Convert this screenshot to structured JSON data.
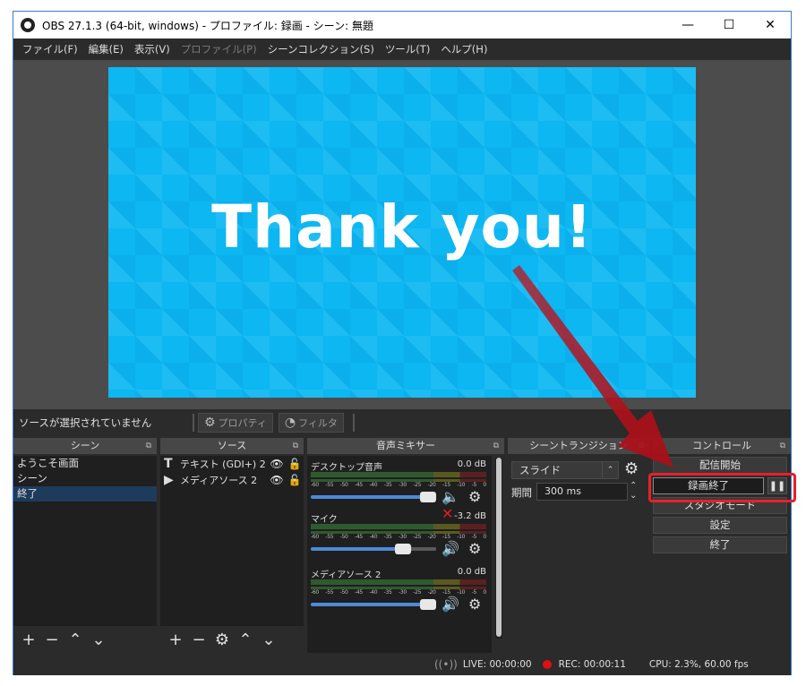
{
  "window": {
    "title": "OBS 27.1.3 (64-bit, windows) - プロファイル: 録画 - シーン: 無題",
    "controls": {
      "minimize": "—",
      "maximize": "☐",
      "close": "✕"
    }
  },
  "menu": [
    {
      "label": "ファイル(F)",
      "disabled": false
    },
    {
      "label": "編集(E)",
      "disabled": false
    },
    {
      "label": "表示(V)",
      "disabled": false
    },
    {
      "label": "プロファイル(P)",
      "disabled": true
    },
    {
      "label": "シーンコレクション(S)",
      "disabled": false
    },
    {
      "label": "ツール(T)",
      "disabled": false
    },
    {
      "label": "ヘルプ(H)",
      "disabled": false
    }
  ],
  "preview": {
    "text": "Thank you!",
    "bg_color": "#0cb7f2"
  },
  "source_toolbar": {
    "no_selection": "ソースが選択されていません",
    "properties": "プロパティ",
    "filters": "フィルタ"
  },
  "scenes": {
    "title": "シーン",
    "items": [
      {
        "label": "ようこそ画面",
        "selected": false
      },
      {
        "label": "シーン",
        "selected": false
      },
      {
        "label": "終了",
        "selected": true
      }
    ]
  },
  "sources": {
    "title": "ソース",
    "items": [
      {
        "label": "テキスト (GDI+) 2",
        "icon": "text-icon"
      },
      {
        "label": "メディアソース 2",
        "icon": "play-icon"
      }
    ]
  },
  "mixer": {
    "title": "音声ミキサー",
    "ticks": [
      "-60",
      "-55",
      "-50",
      "-45",
      "-40",
      "-35",
      "-30",
      "-25",
      "-20",
      "-15",
      "-10",
      "-5",
      "0"
    ],
    "channels": [
      {
        "name": "デスクトップ音声",
        "db": "0.0 dB",
        "level": 1.0,
        "muted": true
      },
      {
        "name": "マイク",
        "db": "-3.2 dB",
        "level": 0.8,
        "muted": false
      },
      {
        "name": "メディアソース 2",
        "db": "0.0 dB",
        "level": 1.0,
        "muted": false
      }
    ]
  },
  "transition": {
    "title": "シーントランジション",
    "selected": "スライド",
    "duration_label": "期間",
    "duration_value": "300 ms"
  },
  "controls": {
    "title": "コントロール",
    "start_stream": "配信開始",
    "stop_recording": "録画終了",
    "pause": "❚❚",
    "studio_mode": "スタジオモード",
    "settings": "設定",
    "exit": "終了"
  },
  "status": {
    "live": "LIVE: 00:00:00",
    "rec": "REC: 00:00:11",
    "cpu": "CPU: 2.3%, 60.00 fps"
  },
  "colors": {
    "accent_red": "#e8202a",
    "selection": "#1e3b5c",
    "slider": "#4d8ad8"
  }
}
